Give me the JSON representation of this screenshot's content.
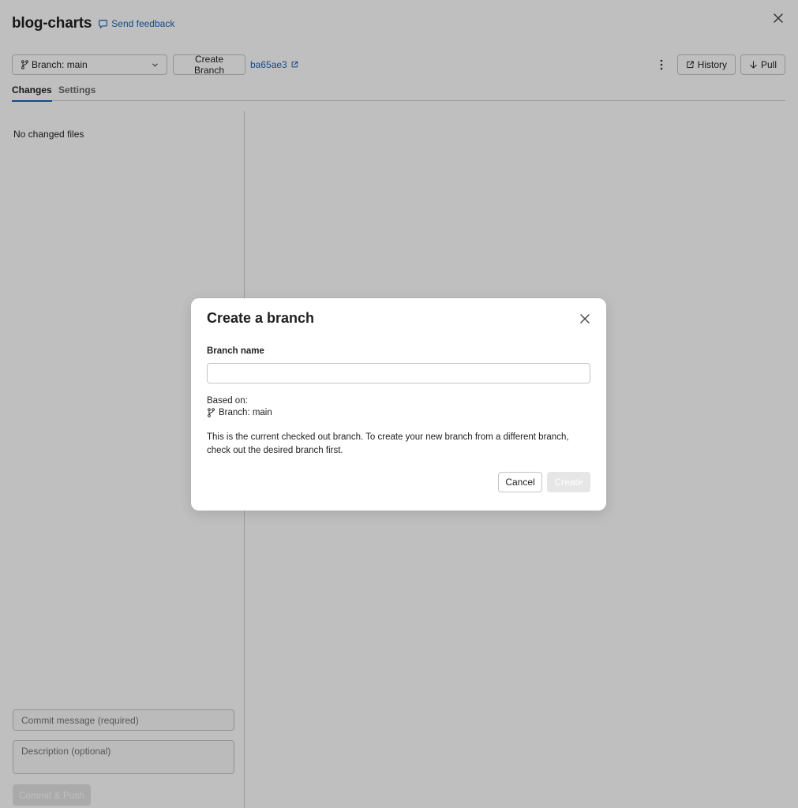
{
  "header": {
    "repo_title": "blog-charts",
    "feedback_label": "Send feedback"
  },
  "toolbar": {
    "branch_label": "Branch: main",
    "create_branch_label": "Create Branch",
    "commit_hash": "ba65ae3",
    "history_label": "History",
    "pull_label": "Pull"
  },
  "tabs": [
    {
      "label": "Changes",
      "active": true
    },
    {
      "label": "Settings",
      "active": false
    }
  ],
  "changes": {
    "empty_text": "No changed files",
    "commit_message_placeholder": "Commit message (required)",
    "description_placeholder": "Description (optional)",
    "commit_push_label": "Commit & Push"
  },
  "modal": {
    "title": "Create a branch",
    "branch_name_label": "Branch name",
    "branch_name_value": "",
    "based_on_label": "Based on:",
    "based_on_branch": "Branch: main",
    "help_text": "This is the current checked out branch. To create your new branch from a different branch, check out the desired branch first.",
    "cancel_label": "Cancel",
    "create_label": "Create"
  },
  "icons": {
    "branch": "git-branch-icon",
    "chevron": "chevron-down-icon",
    "external": "external-link-icon",
    "more": "more-vertical-icon",
    "history": "external-link-icon",
    "pull": "arrow-down-icon",
    "close": "close-icon",
    "feedback": "speech-bubble-icon"
  },
  "colors": {
    "accent": "#1b63b8",
    "overlay": "rgba(0,0,0,0.25)"
  }
}
